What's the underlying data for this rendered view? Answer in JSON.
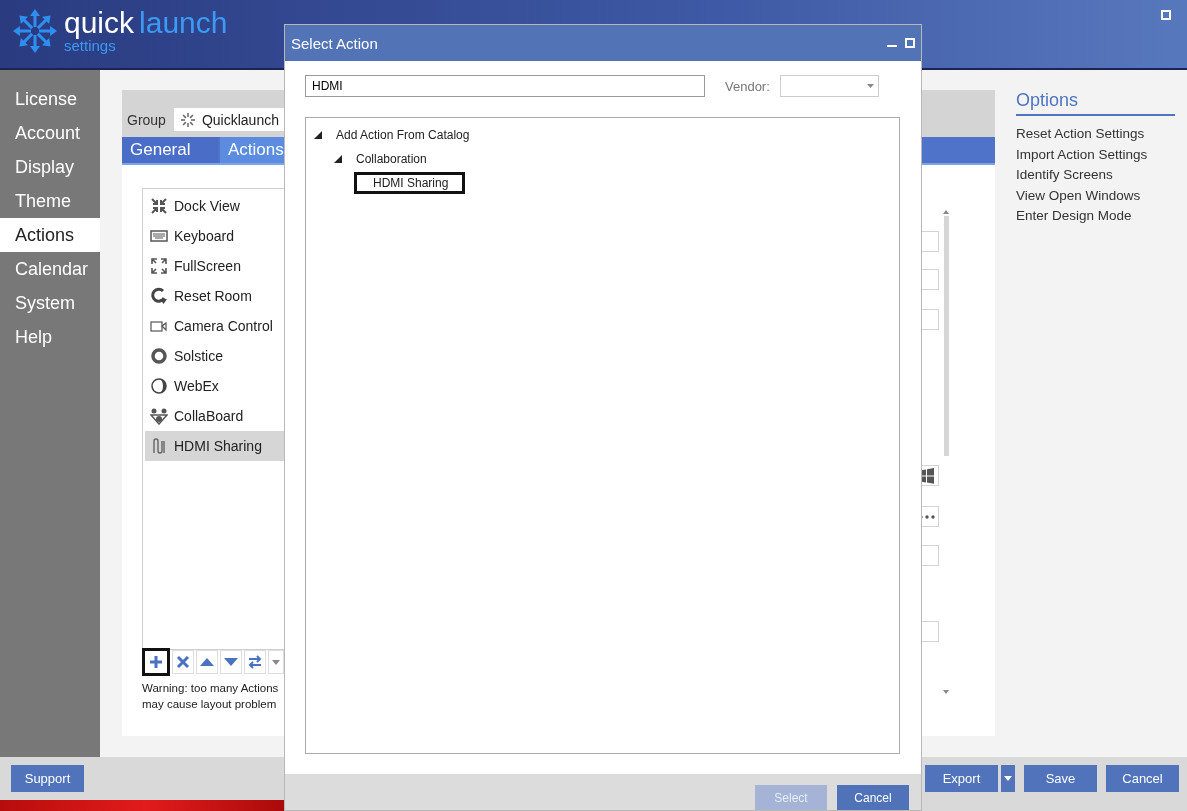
{
  "app": {
    "logo": {
      "word_1": "quick",
      "word_2": "launch",
      "subtitle": "settings"
    }
  },
  "sidebar": {
    "items": [
      {
        "label": "License",
        "selected": false
      },
      {
        "label": "Account",
        "selected": false
      },
      {
        "label": "Display",
        "selected": false
      },
      {
        "label": "Theme",
        "selected": false
      },
      {
        "label": "Actions",
        "selected": true
      },
      {
        "label": "Calendar",
        "selected": false
      },
      {
        "label": "System",
        "selected": false
      },
      {
        "label": "Help",
        "selected": false
      }
    ]
  },
  "group": {
    "label": "Group",
    "value": "Quicklaunch"
  },
  "tabs": [
    {
      "label": "General",
      "selected": false
    },
    {
      "label": "Actions",
      "selected": true
    }
  ],
  "actions": {
    "items": [
      {
        "label": "Dock View",
        "selected": false
      },
      {
        "label": "Keyboard",
        "selected": false
      },
      {
        "label": "FullScreen",
        "selected": false
      },
      {
        "label": "Reset Room",
        "selected": false
      },
      {
        "label": "Camera Control",
        "selected": false
      },
      {
        "label": "Solstice",
        "selected": false
      },
      {
        "label": "WebEx",
        "selected": false
      },
      {
        "label": "CollaBoard",
        "selected": false
      },
      {
        "label": "HDMI Sharing",
        "selected": true
      }
    ]
  },
  "toolbar": [
    {
      "kind": "add",
      "focused": true
    },
    {
      "kind": "delete",
      "focused": false
    },
    {
      "kind": "up",
      "focused": false
    },
    {
      "kind": "down",
      "focused": false
    },
    {
      "kind": "swap",
      "focused": false
    },
    {
      "kind": "more",
      "focused": false
    }
  ],
  "warning": [
    "Warning: too many Actions",
    "may cause layout problem"
  ],
  "options": {
    "title": "Options",
    "links": [
      "Reset Action Settings",
      "Import Action Settings",
      "Identify Screens",
      "View Open Windows",
      "Enter Design Mode"
    ]
  },
  "footer": {
    "support": "Support",
    "export": "Export",
    "save": "Save",
    "cancel": "Cancel"
  },
  "dialog": {
    "title": "Select Action",
    "search": {
      "value": "HDMI"
    },
    "vendor": {
      "label": "Vendor:"
    },
    "tree": [
      {
        "label": "Add Action From Catalog",
        "expanded": true,
        "selected": false,
        "children": [
          {
            "label": "Collaboration",
            "expanded": true,
            "selected": false,
            "children": [
              {
                "label": "HDMI Sharing",
                "selected": true
              }
            ]
          }
        ]
      }
    ],
    "buttons": [
      {
        "label": "Select",
        "disabled": true
      },
      {
        "label": "Cancel",
        "disabled": false
      }
    ]
  }
}
